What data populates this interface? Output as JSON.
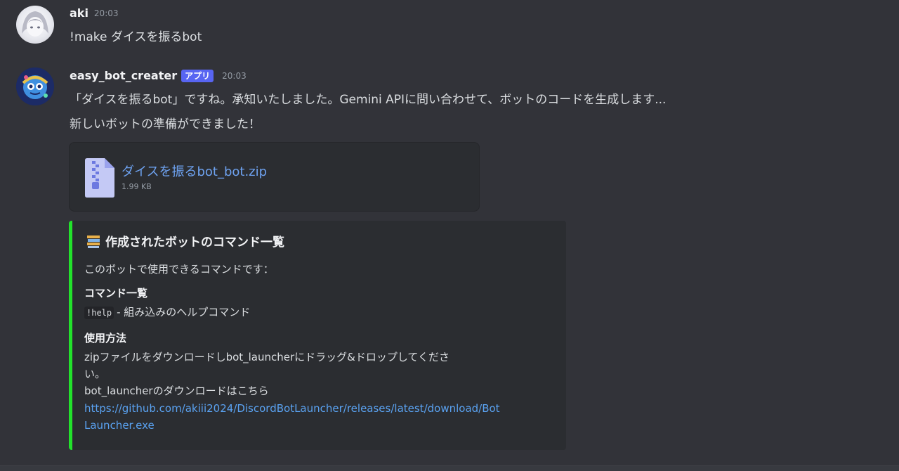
{
  "messages": [
    {
      "author": "aki",
      "time": "20:03",
      "text": "!make ダイスを振るbot"
    },
    {
      "author": "easy_bot_creater",
      "badge": "アプリ",
      "time": "20:03",
      "lines": [
        "「ダイスを振るbot」ですね。承知いたしました。Gemini APIに問い合わせて、ボットのコードを生成します...",
        "新しいボットの準備ができました！"
      ],
      "attachment": {
        "file_name": "ダイスを振るbot_bot.zip",
        "file_size": "1.99 KB",
        "icon": "zip-file-icon"
      },
      "embed": {
        "accent_color": "#22e22b",
        "title_emoji": "books-icon",
        "title": "作成されたボットのコマンド一覧",
        "description": "このボットで使用できるコマンドです：",
        "section1_heading": "コマンド一覧",
        "command_code": "!help",
        "command_desc": "- 組み込みのヘルプコマンド",
        "section2_heading": "使用方法",
        "usage_line1": "zipファイルをダウンロードしbot_launcherにドラッグ&ドロップしてくださ",
        "usage_line2": "い。",
        "usage_line3": "bot_launcherのダウンロードはこちら",
        "link_line1": "https://github.com/akiii2024/DiscordBotLauncher/releases/latest/download/Bot",
        "link_line2": "Launcher.exe"
      }
    }
  ],
  "colors": {
    "background": "#323339",
    "app_badge": "#5865f2",
    "link": "#5aa2f1"
  }
}
